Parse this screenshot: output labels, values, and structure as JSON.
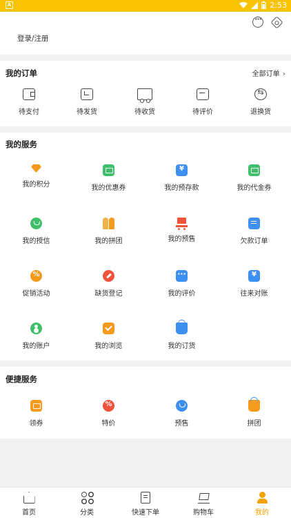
{
  "status_bar": {
    "time": "2:53"
  },
  "header": {
    "login_label": "登录/注册"
  },
  "orders": {
    "title": "我的订单",
    "all_label": "全部订单",
    "items": [
      {
        "label": "待支付",
        "icon": "wallet-icon"
      },
      {
        "label": "待发货",
        "icon": "box-icon"
      },
      {
        "label": "待收货",
        "icon": "truck-icon"
      },
      {
        "label": "待评价",
        "icon": "review-icon"
      },
      {
        "label": "退换货",
        "icon": "exchange-icon"
      }
    ]
  },
  "services": {
    "title": "我的服务",
    "items": [
      {
        "label": "我的积分",
        "icon": "diamond-icon",
        "color": "#f49a1d"
      },
      {
        "label": "我的优惠券",
        "icon": "coupon-icon",
        "color": "#3fbf6a"
      },
      {
        "label": "我的预存款",
        "icon": "deposit-icon",
        "color": "#3d8ff0"
      },
      {
        "label": "我的代金券",
        "icon": "voucher-icon",
        "color": "#3fbf6a"
      },
      {
        "label": "我的授信",
        "icon": "credit-icon",
        "color": "#3fbf6a"
      },
      {
        "label": "我的拼团",
        "icon": "group-icon",
        "color": "#f49a1d"
      },
      {
        "label": "我的预售",
        "icon": "cart-icon",
        "color": "#f0523a"
      },
      {
        "label": "欠款订单",
        "icon": "document-icon",
        "color": "#3d8ff0"
      },
      {
        "label": "促销活动",
        "icon": "promotion-icon",
        "color": "#f49a1d"
      },
      {
        "label": "缺货登记",
        "icon": "pen-icon",
        "color": "#f0523a"
      },
      {
        "label": "我的评价",
        "icon": "chat-icon",
        "color": "#3d8ff0"
      },
      {
        "label": "往来对账",
        "icon": "yuan-icon",
        "color": "#3d8ff0"
      },
      {
        "label": "我的账户",
        "icon": "account-icon",
        "color": "#3fbf6a"
      },
      {
        "label": "我的浏览",
        "icon": "browse-icon",
        "color": "#f49a1d"
      },
      {
        "label": "我的订货",
        "icon": "basket-icon",
        "color": "#3d8ff0"
      }
    ]
  },
  "quick": {
    "title": "便捷服务",
    "items": [
      {
        "label": "领券",
        "icon": "coupon-collect-icon",
        "color": "#f49a1d"
      },
      {
        "label": "特价",
        "icon": "flash-sale-icon",
        "color": "#f0523a"
      },
      {
        "label": "预售",
        "icon": "alarm-clock-icon",
        "color": "#3d8ff0"
      },
      {
        "label": "拼团",
        "icon": "group-bag-icon",
        "color": "#f49a1d"
      }
    ]
  },
  "tabbar": {
    "tabs": [
      {
        "label": "首页",
        "icon": "home-icon"
      },
      {
        "label": "分类",
        "icon": "category-icon"
      },
      {
        "label": "快速下单",
        "icon": "quick-order-icon"
      },
      {
        "label": "购物车",
        "icon": "cart-icon"
      },
      {
        "label": "我的",
        "icon": "user-icon"
      }
    ],
    "active_color": "#f2a200"
  }
}
